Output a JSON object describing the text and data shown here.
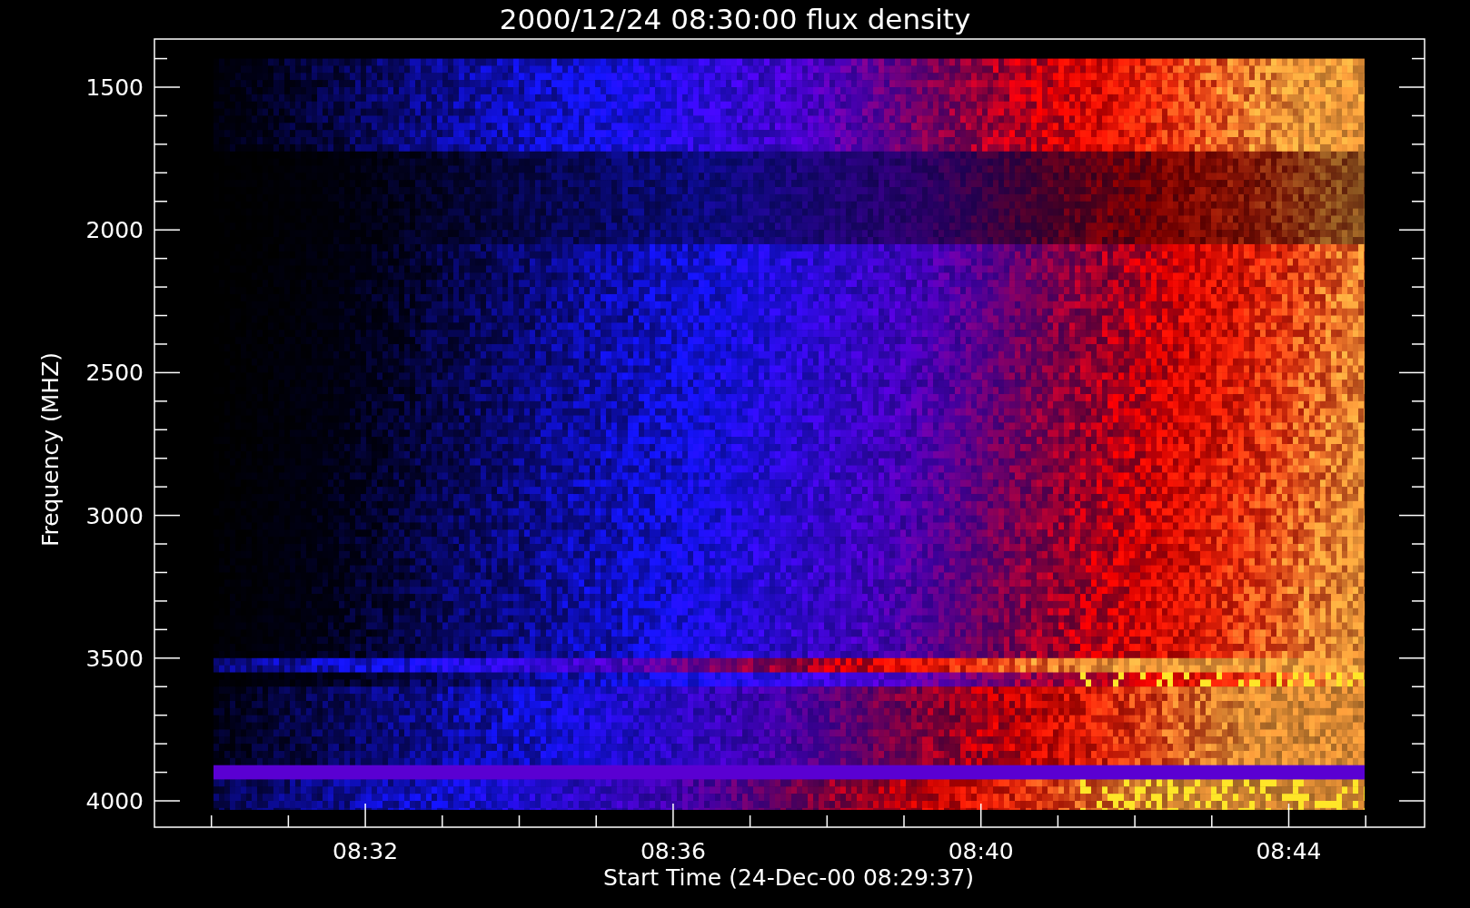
{
  "title": "2000/12/24 08:30:00 flux density",
  "y_axis": {
    "label": "Frequency (MHZ)",
    "ticks": [
      "1500",
      "2000",
      "2500",
      "3000",
      "3500",
      "4000"
    ]
  },
  "x_axis": {
    "label": "Start Time (24-Dec-00 08:29:37)",
    "ticks": [
      "08:32",
      "08:36",
      "08:40",
      "08:44"
    ]
  }
}
